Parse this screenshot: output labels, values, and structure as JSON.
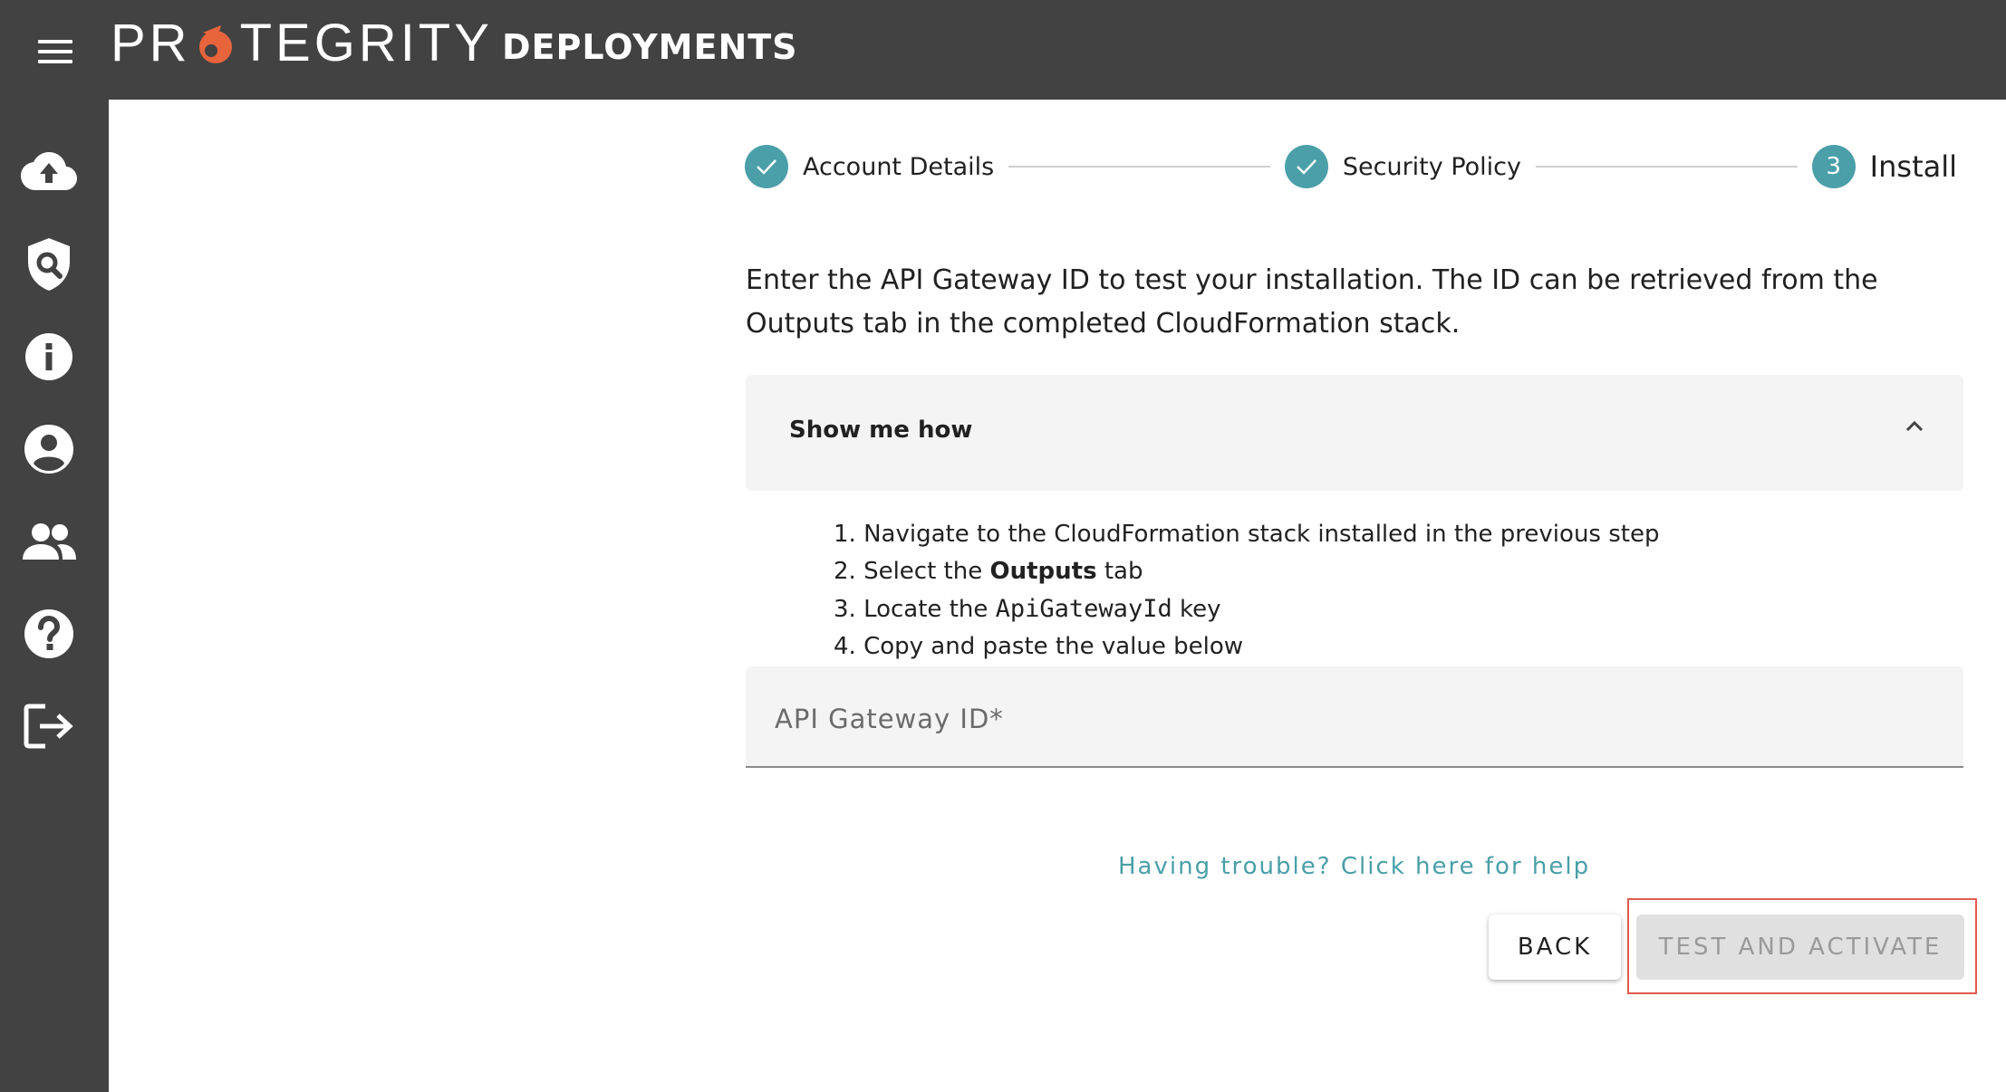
{
  "header": {
    "logo_text_left": "PR",
    "logo_text_right": "TEGRITY",
    "app_title": "DEPLOYMENTS",
    "colors": {
      "bar": "#424242",
      "logo_accent": "#e8643c"
    }
  },
  "sidebar": {
    "items": [
      {
        "icon": "cloud-upload-icon"
      },
      {
        "icon": "shield-search-icon"
      },
      {
        "icon": "info-icon"
      },
      {
        "icon": "account-circle-icon"
      },
      {
        "icon": "group-icon"
      },
      {
        "icon": "help-icon"
      },
      {
        "icon": "logout-icon"
      }
    ]
  },
  "stepper": {
    "steps": [
      {
        "label": "Account Details",
        "state": "completed"
      },
      {
        "label": "Security Policy",
        "state": "completed"
      },
      {
        "label": "Install",
        "number": "3",
        "state": "active"
      }
    ],
    "accent": "#4a9fa8"
  },
  "instruction": {
    "text": "Enter the API Gateway ID to test your installation. The ID can be retrieved from the Outputs tab in the completed CloudFormation stack."
  },
  "accordion": {
    "title": "Show me how",
    "expanded": true,
    "steps": [
      {
        "num": "1.",
        "text": "Navigate to the CloudFormation stack installed in the previous step"
      },
      {
        "num": "2.",
        "pre": "Select the ",
        "bold": "Outputs",
        "post": " tab"
      },
      {
        "num": "3.",
        "pre": "Locate the ",
        "code": "ApiGatewayId",
        "post": " key"
      },
      {
        "num": "4.",
        "text": "Copy and paste the value below"
      }
    ]
  },
  "form": {
    "api_gateway_placeholder": "API Gateway ID*",
    "api_gateway_value": ""
  },
  "help_link": "Having trouble? Click here for help",
  "actions": {
    "back_label": "BACK",
    "test_label": "TEST AND ACTIVATE",
    "test_disabled": true
  }
}
